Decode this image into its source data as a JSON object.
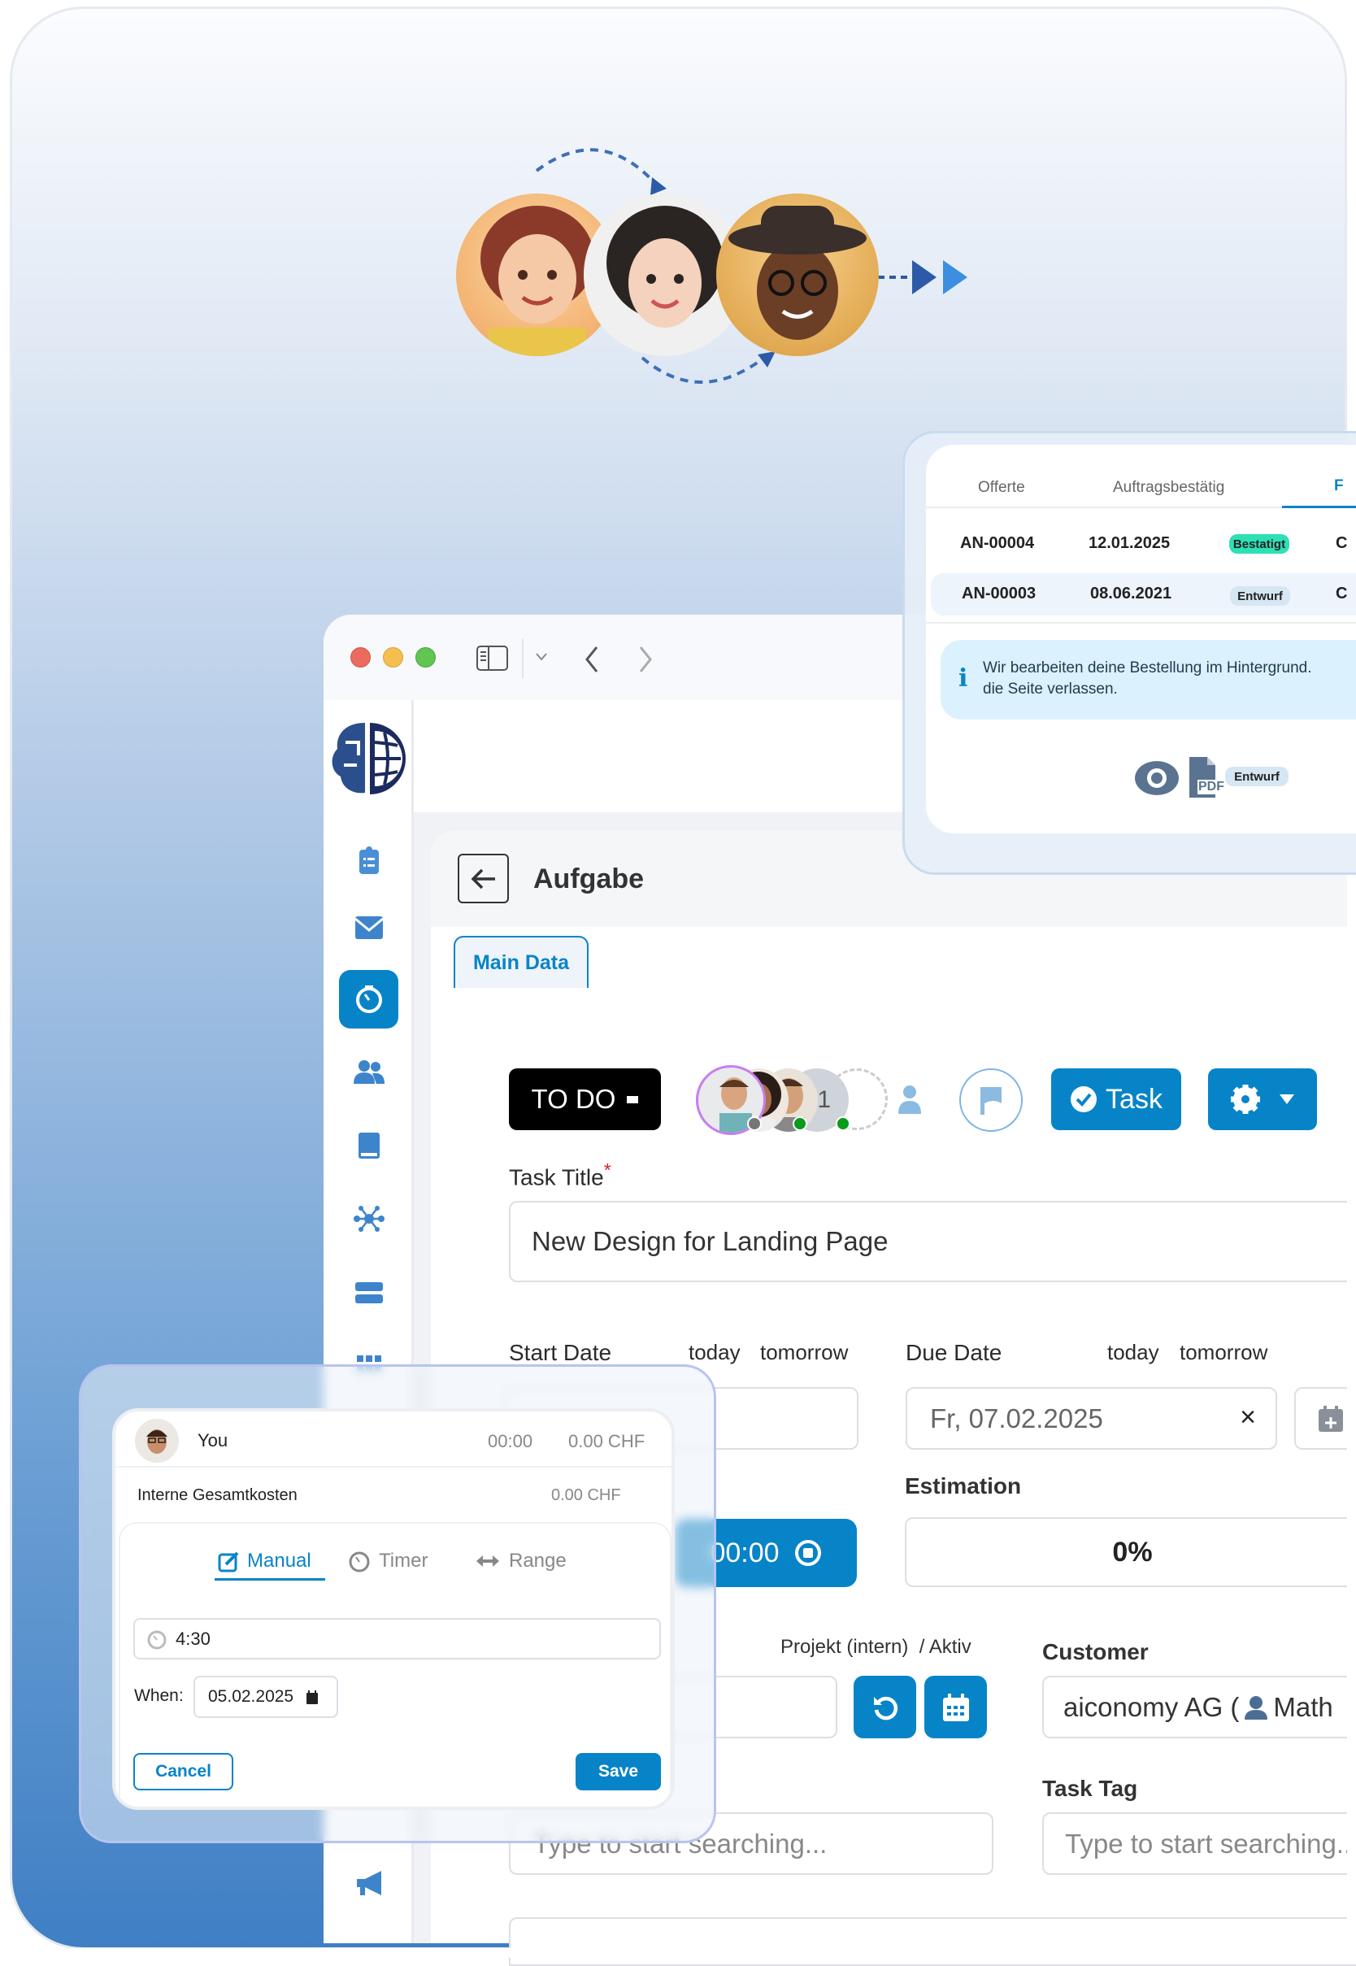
{
  "quote_panel": {
    "tabs": [
      "Offerte",
      "Auftragsbestätig",
      "F"
    ],
    "rows": [
      {
        "number": "AN-00004",
        "date": "12.01.2025",
        "status": "Bestatigt",
        "extra": "C"
      },
      {
        "number": "AN-00003",
        "date": "08.06.2021",
        "status": "Entwurf",
        "extra": "C"
      }
    ],
    "info_line1": "Wir bearbeiten deine Bestellung im Hintergrund.",
    "info_line2": "die Seite verlassen.",
    "info_icon": "i",
    "pdf_label": "PDF",
    "doc_status": "Entwurf",
    "colors": {
      "bestatigt": "#2ee0b6",
      "entwurf": "#d6e6f2",
      "info_bg": "#dbf1fd"
    }
  },
  "window": {
    "page_title": "Aufgabe",
    "tab_main": "Main Data",
    "status_label": "TO DO",
    "assignee_more": "+1",
    "type_button": "Task",
    "task_title_label": "Task Title",
    "required_mark": "*",
    "task_title_value": "New Design for Landing Page",
    "start_date_label": "Start Date",
    "due_date_label": "Due Date",
    "today": "today",
    "tomorrow": "tomorrow",
    "due_date_value": "Fr, 07.02.2025",
    "clear": "×",
    "estimation_label": "Estimation",
    "estimation_value": "0%",
    "timer_value": "00:00",
    "project_label": "Projekt (intern)  / Aktiv",
    "customer_label": "Customer",
    "customer_value": "aiconomy AG (",
    "customer_contact": "Math",
    "task_tag_label": "Task Tag",
    "search_placeholder": "Type to start searching...",
    "accent": "#0784c8"
  },
  "time_popup": {
    "user": "You",
    "time": "00:00",
    "cost": "0.00 CHF",
    "total_label": "Interne Gesamtkosten",
    "total_value": "0.00 CHF",
    "tabs": [
      "Manual",
      "Timer",
      "Range"
    ],
    "active_tab": "Manual",
    "duration": "4:30",
    "when_label": "When:",
    "when_value": "05.02.2025",
    "cancel": "Cancel",
    "save": "Save"
  }
}
